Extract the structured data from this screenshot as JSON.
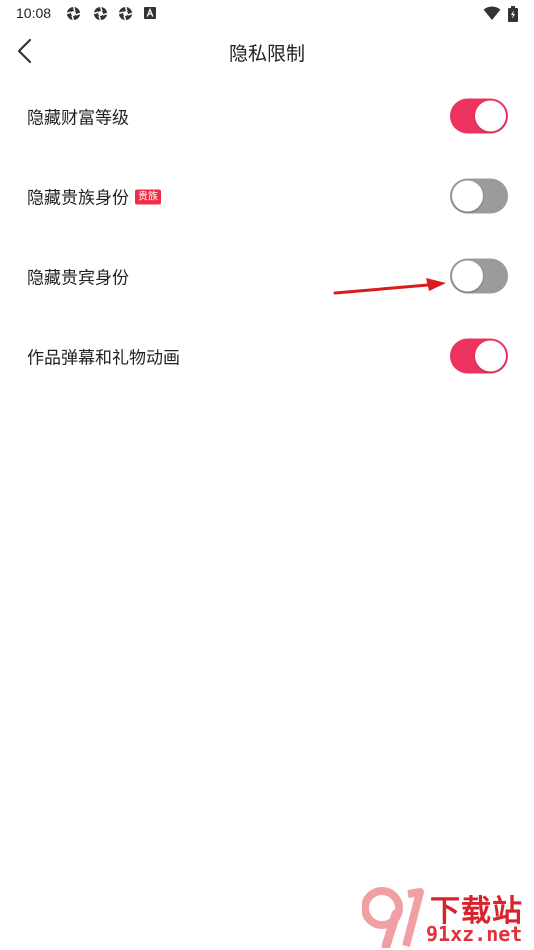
{
  "status_bar": {
    "time": "10:08",
    "left_icons": [
      "aperture-icon",
      "aperture-icon",
      "aperture-icon",
      "a-box-icon"
    ],
    "right_icons": [
      "wifi-icon",
      "battery-charging-icon"
    ]
  },
  "header": {
    "back_icon": "chevron-left-icon",
    "title": "隐私限制"
  },
  "settings": [
    {
      "label": "隐藏财富等级",
      "badge": "",
      "enabled": true
    },
    {
      "label": "隐藏贵族身份",
      "badge": "贵族",
      "enabled": false
    },
    {
      "label": "隐藏贵宾身份",
      "badge": "",
      "enabled": false
    },
    {
      "label": "作品弹幕和礼物动画",
      "badge": "",
      "enabled": true
    }
  ],
  "colors": {
    "toggle_on": "#ef3360",
    "toggle_off": "#9b9b9b",
    "badge": "#f12d45",
    "annotation_arrow": "#d91b1b"
  },
  "annotation": {
    "type": "arrow",
    "target": "settings.2"
  },
  "watermark": {
    "logo_number": "91",
    "text": "下载站",
    "domain": "91xz.net"
  }
}
